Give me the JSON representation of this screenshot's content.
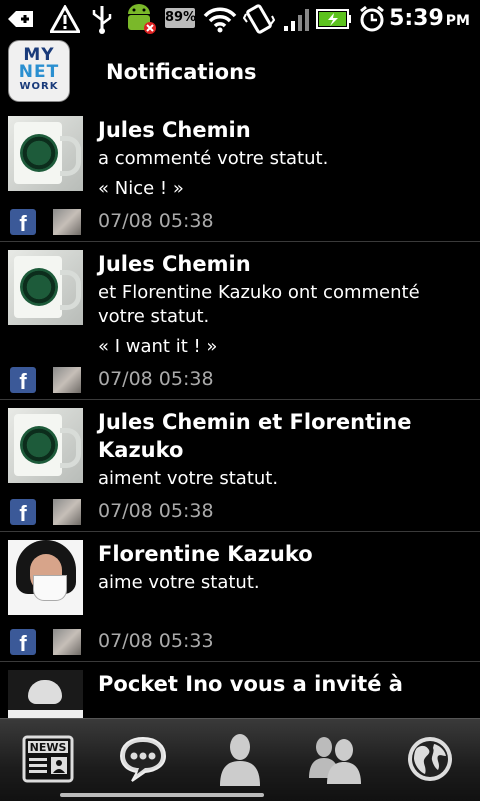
{
  "status_bar": {
    "battery_percent_label": "89%",
    "time": "5:39",
    "ampm": "PM",
    "icons": [
      "add-icon",
      "warning-icon",
      "usb-icon",
      "android-icon",
      "wifi-icon",
      "vibrate-icon",
      "signal-icon",
      "battery-charging-icon",
      "alarm-icon"
    ]
  },
  "header": {
    "logo": {
      "line1": "MY",
      "line2": "NET",
      "line3": "WORK"
    },
    "title": "Notifications"
  },
  "notifications": [
    {
      "name": "Jules Chemin",
      "message": "a commenté votre statut.",
      "quote": "« Nice ! »",
      "time": "07/08 05:38",
      "avatar": "starbucks-cup"
    },
    {
      "name": "Jules Chemin",
      "message": "et Florentine Kazuko ont commenté votre statut.",
      "quote": "« I want it ! »",
      "time": "07/08 05:38",
      "avatar": "starbucks-cup"
    },
    {
      "name": "Jules Chemin et Florentine Kazuko",
      "message": "aiment votre statut.",
      "quote": "",
      "time": "07/08 05:38",
      "avatar": "starbucks-cup"
    },
    {
      "name": "Florentine Kazuko",
      "message": "aime votre statut.",
      "quote": "",
      "time": "07/08 05:33",
      "avatar": "woman-with-cup"
    },
    {
      "name": "Pocket Ino vous a invité à",
      "message": "",
      "quote": "",
      "time": "",
      "avatar": "skull"
    }
  ],
  "tab_bar": {
    "news_label": "NEWS",
    "tabs": [
      "news-tab",
      "chat-tab",
      "profile-tab",
      "friends-tab",
      "globe-tab"
    ]
  },
  "colors": {
    "background": "#000000",
    "facebook": "#3b5998",
    "accent": "#2a8fd0"
  }
}
